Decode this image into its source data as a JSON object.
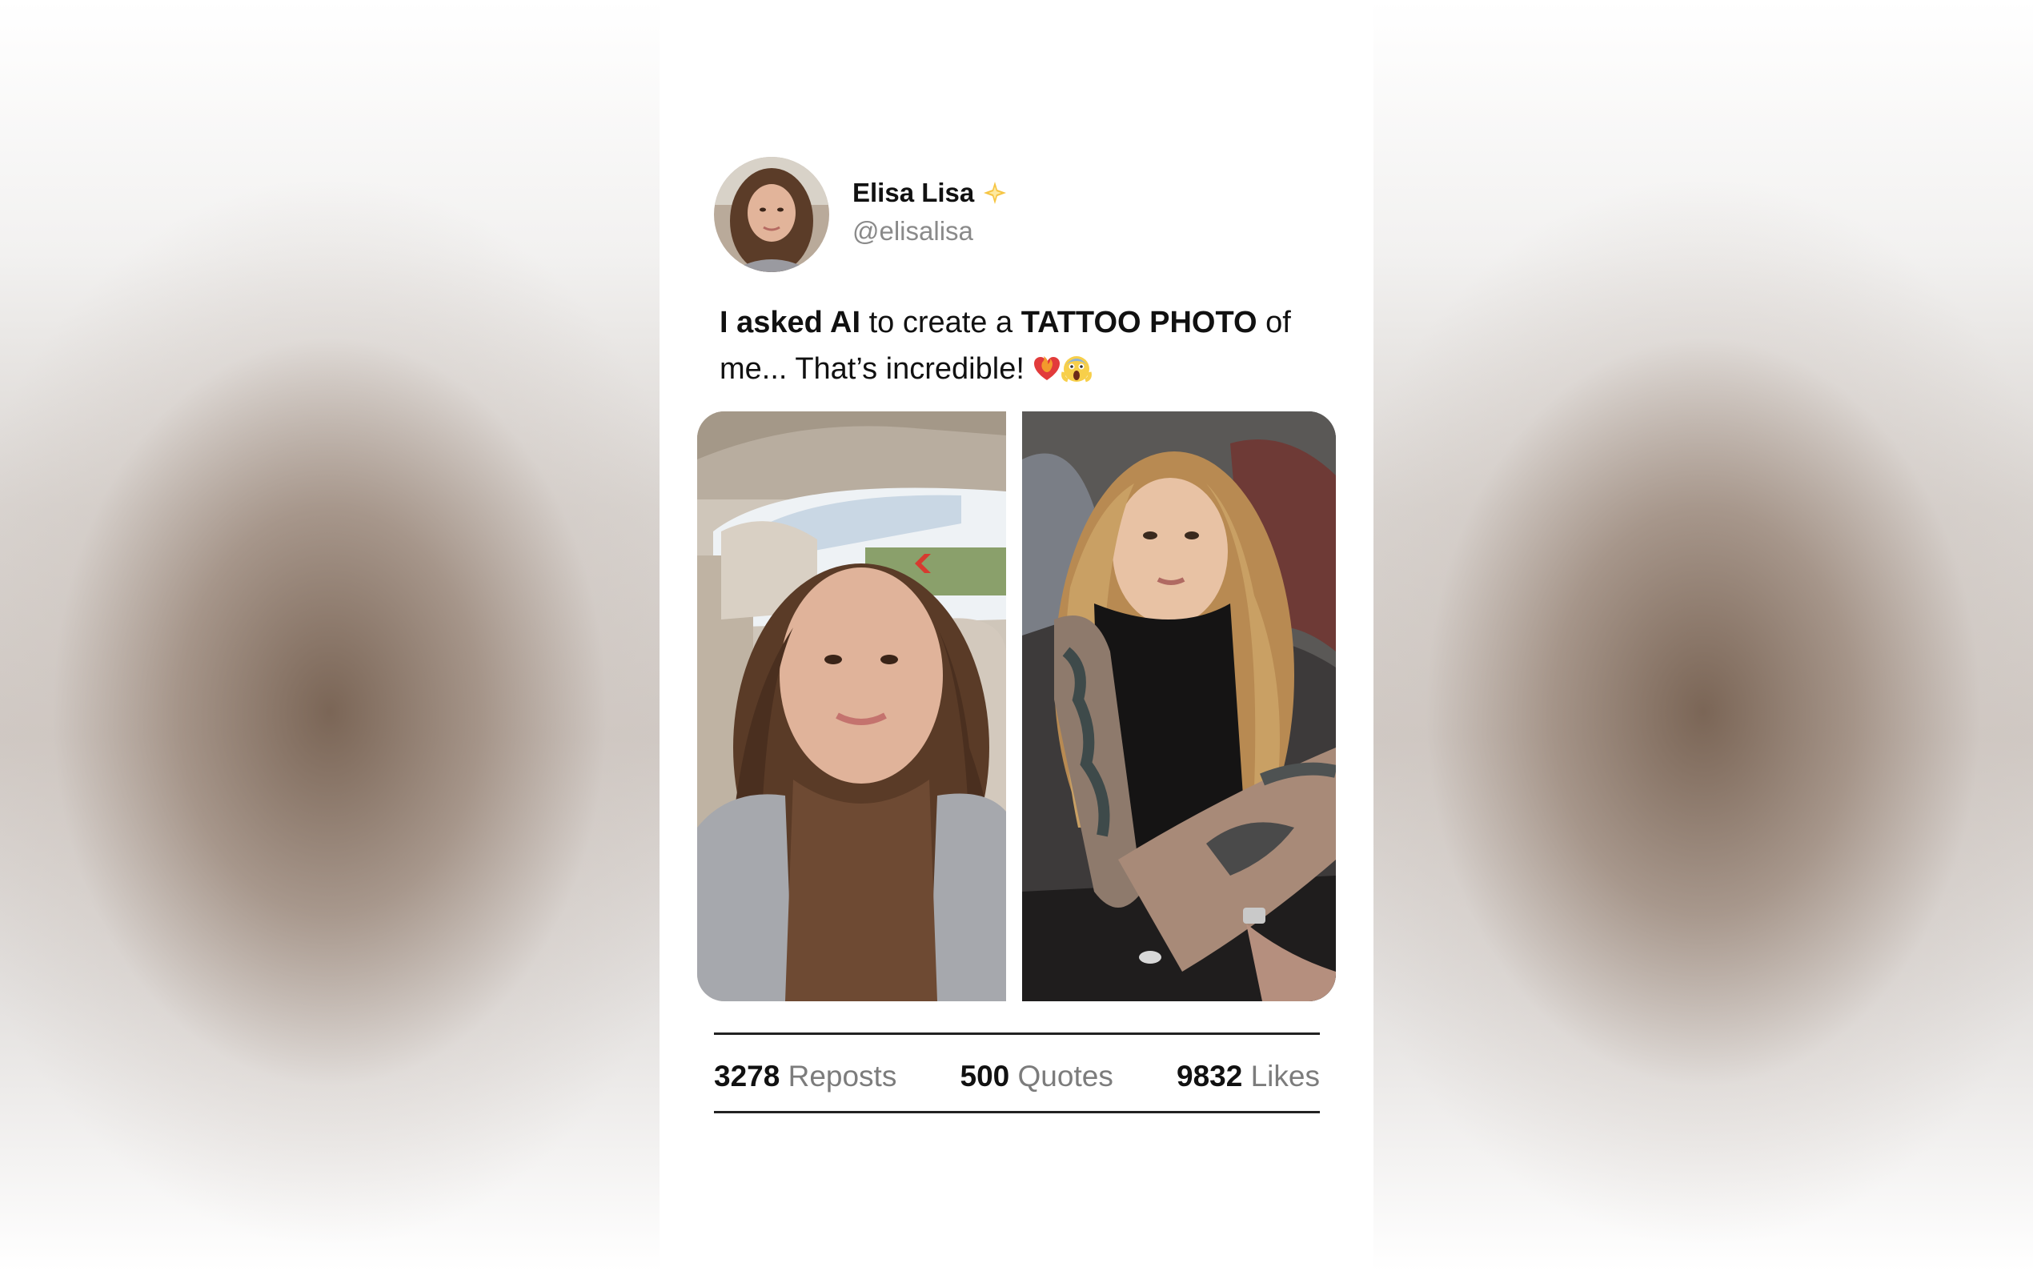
{
  "post": {
    "author": {
      "name": "Elisa Lisa",
      "handle": "@elisalisa",
      "badge_icon": "sparkle-star-icon"
    },
    "text": {
      "part1_bold": "I asked AI",
      "part2": " to create a ",
      "part3_bold": "TATTOO PHOTO",
      "part4": " of me... That’s incredible! ",
      "emojis": [
        "heart-on-fire-emoji",
        "screaming-face-emoji"
      ]
    },
    "media": {
      "images": [
        "original-selfie-photo",
        "ai-tattoo-photo"
      ]
    },
    "stats": {
      "reposts": {
        "count": "3278",
        "label": "Reposts"
      },
      "quotes": {
        "count": "500",
        "label": "Quotes"
      },
      "likes": {
        "count": "9832",
        "label": "Likes"
      }
    }
  },
  "colors": {
    "card_background": "#ffffff",
    "text_primary": "#111111",
    "text_secondary": "#7c7c7c",
    "divider": "#222222"
  }
}
